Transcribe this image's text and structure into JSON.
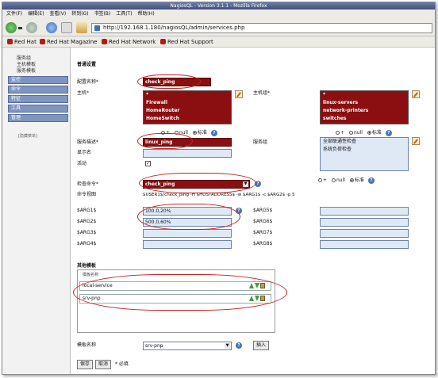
{
  "window": {
    "title": "NagiosQL - Version 3.1.1 - Mozilla Firefox"
  },
  "menu": [
    "文件(F)",
    "编辑(E)",
    "查看(V)",
    "转到(G)",
    "书签(B)",
    "工具(T)",
    "帮助(H)"
  ],
  "url": "http://192.168.1.180/nagiosQL/admin/services.php",
  "bookmarks": [
    "Red Hat",
    "Red Hat Magazine",
    "Red Hat Network",
    "Red Hat Support"
  ],
  "sidebar": {
    "subnav": [
      "服务组",
      "主机模板",
      "服务模板"
    ],
    "items": [
      "监控",
      "命令",
      "特征",
      "工具",
      "管理"
    ],
    "hide": "[隐藏菜单]"
  },
  "form": {
    "section_general": "普通设置",
    "config_name_label": "配置名称*",
    "config_name_value": "check_ping",
    "host_label": "主机*",
    "host_list": [
      "*",
      "Firewall",
      "HomeRouter",
      "HomeSwitch"
    ],
    "hostgroup_label": "主机组*",
    "hostgroup_list": [
      "*",
      "linux-servers",
      "network-printers",
      "switches"
    ],
    "radio_plus": "+",
    "radio_null": "null",
    "radio_std": "标准",
    "service_desc_label": "服务描述*",
    "service_desc_value": "linux_ping",
    "service_group_label": "服务组",
    "service_group_list": [
      "全部联通性检查",
      "系统负荷检查"
    ],
    "display_name_label": "显示名",
    "active_label": "活动",
    "active_check": "✓",
    "check_cmd_label": "检查命令*",
    "check_cmd_value": "check_ping",
    "cmd_view_label": "命令视图",
    "cmd_view_value": "$USER1$/check_ping -H $HOSTADDRESS$ -w $ARG1$ -c $ARG2$ -p 5",
    "args_left": [
      {
        "label": "$ARG1$",
        "value": "100.0,20%"
      },
      {
        "label": "$ARG2$",
        "value": "500.0,60%"
      },
      {
        "label": "$ARG3$",
        "value": ""
      },
      {
        "label": "$ARG4$",
        "value": ""
      }
    ],
    "args_right": [
      {
        "label": "$ARG5$",
        "value": ""
      },
      {
        "label": "$ARG6$",
        "value": ""
      },
      {
        "label": "$ARG7$",
        "value": ""
      },
      {
        "label": "$ARG8$",
        "value": ""
      }
    ],
    "section_template": "其他模板",
    "template_caption": "模板名称",
    "templates": [
      "local-service",
      "srv-pnp"
    ],
    "template_name_label": "模板名称",
    "template_select": "srv-pnp",
    "insert_button": "插入",
    "save_button": "保存",
    "cancel_button": "取消",
    "required_note": "* 必填"
  },
  "colors": {
    "dark_red": "#8b0f10",
    "field_blue": "#dfe9f6",
    "nav_blue": "#7f95c0",
    "annotation_red": "#c42020"
  }
}
